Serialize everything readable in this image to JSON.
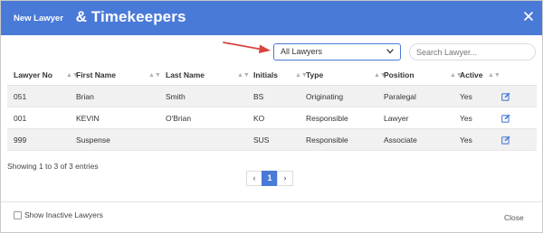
{
  "dialog": {
    "title": "Lawyers & Timekeepers"
  },
  "toolbar": {
    "new_label": "New Lawyer",
    "filter_value": "All Lawyers",
    "search_placeholder": "Search Lawyer..."
  },
  "table": {
    "columns": [
      "Lawyer No",
      "First Name",
      "Last Name",
      "Initials",
      "Type",
      "Position",
      "Active"
    ],
    "rows": [
      [
        "051",
        "Brian",
        "Smith",
        "BS",
        "Originating",
        "Paralegal",
        "Yes"
      ],
      [
        "001",
        "KEVIN",
        "O'Brian",
        "KO",
        "Responsible",
        "Lawyer",
        "Yes"
      ],
      [
        "999",
        "Suspense",
        "",
        "SUS",
        "Responsible",
        "Associate",
        "Yes"
      ]
    ]
  },
  "footer": {
    "entries_info": "Showing 1 to 3 of 3 entries",
    "pages": {
      "prev": "‹",
      "current": "1",
      "next": "›"
    },
    "show_inactive_label": "Show Inactive Lawyers",
    "close_label": "Close"
  },
  "colors": {
    "accent": "#4a7ad8",
    "annotation_arrow": "#d64541"
  },
  "icons": {
    "close": "close-icon",
    "dropdown": "chevron-down-icon",
    "sort": "sort-icon",
    "edit": "edit-icon",
    "annotation": "arrow-icon"
  }
}
